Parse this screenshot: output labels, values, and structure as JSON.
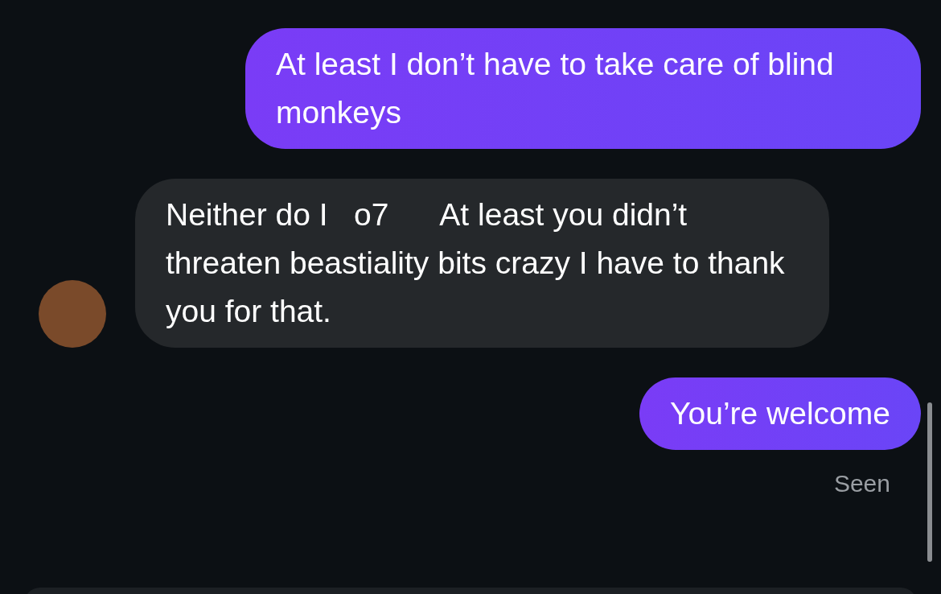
{
  "messages": [
    {
      "kind": "sent",
      "text": "At least I don’t have to take care of blind monkeys"
    },
    {
      "kind": "received",
      "text": "Neither do I   o7      At least you didn’t threaten beastiality bits crazy I have to thank you for that."
    },
    {
      "kind": "sent",
      "text": "You’re welcome"
    }
  ],
  "status": "Seen"
}
